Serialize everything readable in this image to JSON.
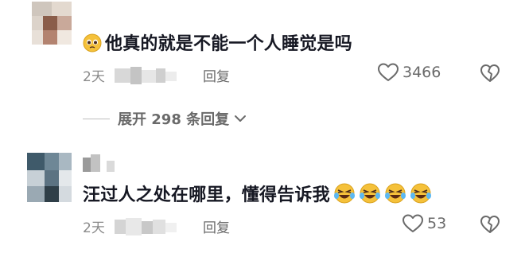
{
  "comments": [
    {
      "text": "他真的就是不能一个人睡觉是吗",
      "time": "2天",
      "reply_label": "回复",
      "likes": "3466",
      "leading_emoji": "pleading-face-emoji"
    },
    {
      "text": "汪过人之处在哪里，懂得告诉我",
      "time": "2天",
      "reply_label": "回复",
      "likes": "53",
      "trailing_emoji": "laughing-tears-emoji",
      "trailing_emoji_count": 4
    }
  ],
  "expand_replies": {
    "label": "展开 298 条回复"
  },
  "colors": {
    "text_primary": "#161823",
    "text_secondary": "#8a8a8a",
    "icon": "#6a6a6a",
    "emoji_yellow": "#f5c13a"
  }
}
